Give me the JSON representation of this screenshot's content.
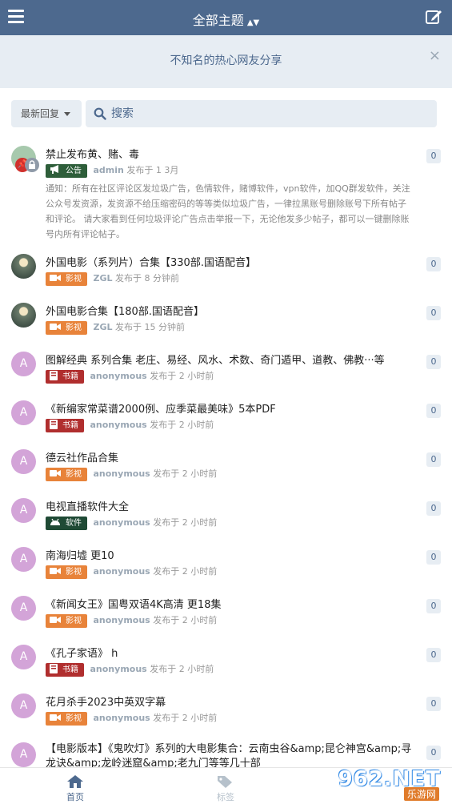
{
  "topbar": {
    "title": "全部主题",
    "sort_icon": "sort-caret-icon",
    "menu_icon": "hamburger-menu-icon",
    "compose_icon": "compose-icon",
    "bg": "#4d698e"
  },
  "hero": {
    "text": "不知名的热心网友分享",
    "close": "×"
  },
  "controls": {
    "sort_label": "最新回复",
    "search_placeholder": "搜索"
  },
  "posts": [
    {
      "title": "禁止发布黄、赌、毒",
      "avatar": "",
      "tag": "公告",
      "author": "admin",
      "time": "发布于 1 3月",
      "excerpt": "通知：所有在社区评论区发垃圾广告，色情软件，赌博软件，vpn软件，加QQ群发软件，关注公众号发资源，发资源不给压缩密码的等等类似垃圾广告，一律拉黑账号删除账号下所有帖子和评论。 请大家看到任何垃圾评论广告点击举报一下，无论他发多少帖子，都可以一键删除账号内所有评论帖子。",
      "replies": "0"
    },
    {
      "title": "外国电影（系列片）合集【330部.国语配音】",
      "avatar": "",
      "tag": "影视",
      "author": "ZGL",
      "time": "发布于 8 分钟前",
      "replies": "0"
    },
    {
      "title": "外国电影合集【180部.国语配音】",
      "avatar": "",
      "tag": "影视",
      "author": "ZGL",
      "time": "发布于 15 分钟前",
      "replies": "0"
    },
    {
      "title": "图解经典 系列合集 老庄、易经、风水、术数、奇门遁甲、道教、佛教···等",
      "avatar": "A",
      "tag": "书籍",
      "author": "anonymous",
      "time": "发布于 2 小时前",
      "replies": "0"
    },
    {
      "title": "《新编家常菜谱2000例、应季菜最美味》5本PDF",
      "avatar": "A",
      "tag": "书籍",
      "author": "anonymous",
      "time": "发布于 2 小时前",
      "replies": "0"
    },
    {
      "title": "德云社作品合集",
      "avatar": "A",
      "tag": "影视",
      "author": "anonymous",
      "time": "发布于 2 小时前",
      "replies": "0"
    },
    {
      "title": "电视直播软件大全",
      "avatar": "A",
      "tag": "软件",
      "author": "anonymous",
      "time": "发布于 2 小时前",
      "replies": "0"
    },
    {
      "title": "南海归墟 更10",
      "avatar": "A",
      "tag": "影视",
      "author": "anonymous",
      "time": "发布于 2 小时前",
      "replies": "0"
    },
    {
      "title": "《新闻女王》国粤双语4K高清 更18集",
      "avatar": "A",
      "tag": "影视",
      "author": "anonymous",
      "time": "发布于 2 小时前",
      "replies": "0"
    },
    {
      "title": "《孔子家语》 h",
      "avatar": "A",
      "tag": "书籍",
      "author": "anonymous",
      "time": "发布于 2 小时前",
      "replies": "0"
    },
    {
      "title": "花月杀手2023中英双字幕",
      "avatar": "A",
      "tag": "影视",
      "author": "anonymous",
      "time": "发布于 2 小时前",
      "replies": "0"
    },
    {
      "title": "【电影版本】《鬼吹灯》系列的大电影集合：云南虫谷&amp;昆仑神宫&amp;寻龙诀&amp;龙岭迷窟&amp;老九门等等几十部",
      "avatar": "A",
      "tag": "",
      "author": "",
      "time": "",
      "replies": "0"
    }
  ],
  "bottomnav": {
    "home_label": "首页",
    "tags_label": "标签"
  },
  "watermark": {
    "line1": "962.NET",
    "line2": "乐游网"
  },
  "colors": {
    "accent": "#4d698e",
    "tag_announce": "#2e5e3a",
    "tag_video": "#e8833a",
    "tag_book": "#b02e2e",
    "tag_software": "#1f4a35",
    "avatar_default": "#d3a4d8"
  }
}
